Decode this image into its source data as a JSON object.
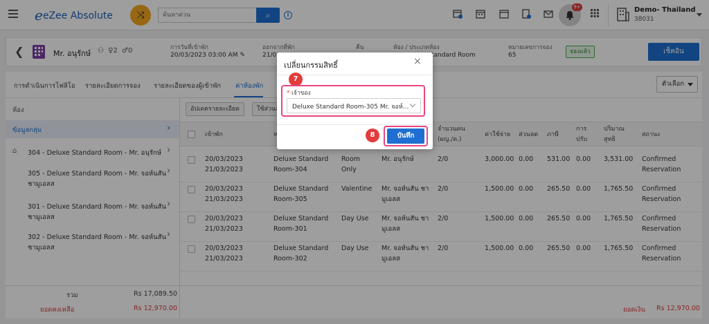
{
  "app": {
    "logo_text": "eZee Absolute",
    "search_placeholder": "ค้นหาด่วน",
    "notification_count": "9+",
    "property_name": "Demo- Thailand",
    "property_id": "38031"
  },
  "reservation": {
    "guest_name": "Mr. อนุรักษ์",
    "adults": "2",
    "children": "0",
    "arrival_label": "การวันที่เข้าพัก",
    "arrival_value": "20/03/2023 03:00 AM",
    "departure_label": "ออกจากที่พัก",
    "departure_value": "21/0",
    "nights_label": "คืน",
    "room_label": "ห้อง / ประเภทห้อง",
    "room_value": "tandard Room",
    "resno_label": "หมายเลขการจอง",
    "resno_value": "65",
    "status_badge": "จองแล้ว",
    "checkin_button": "เช็คอิน"
  },
  "tabs": [
    {
      "label": "การดำเนินการโฟลิโอ"
    },
    {
      "label": "รายละเอียดการจอง"
    },
    {
      "label": "รายละเอียดของผู้เข้าพัก"
    },
    {
      "label": "ค่าห้องพัก"
    }
  ],
  "options_button": "ตัวเลือก",
  "left": {
    "title": "ห้อง",
    "group": "ข้อมูลกลุ่ม",
    "rooms": [
      {
        "line1": "304 - Deluxe Standard Room - Mr. อนุรักษ์",
        "line2": ""
      },
      {
        "line1": "305 - Deluxe Standard Room - Mr. จอห์นสัน",
        "line2": "ชามูเอลส"
      },
      {
        "line1": "301 - Deluxe Standard Room - Mr. จอห์นสัน",
        "line2": "ชามูเอลส"
      },
      {
        "line1": "302 - Deluxe Standard Room - Mr. จอห์นสัน",
        "line2": "ชามูเอลส"
      }
    ],
    "total_label": "รวม",
    "total_value": "Rs 17,089.50",
    "balance_label": "ยอดคงเหลือ",
    "balance_value": "Rs 12,970.00"
  },
  "main": {
    "update_button": "อัปเดตรายละเอียด",
    "discount_button": "ใช้ส่วนล",
    "headers": {
      "checkin": "เข้าพัก",
      "room": "ห",
      "guests": "จำนวนคน",
      "guests2": "(ผญ./ด.)",
      "rate": "ค่าใช้จ่าย",
      "discount": "ส่วนลด",
      "tax": "ภาษี",
      "adjust": "การ",
      "adjust2": "ปรับ",
      "net": "ปริมาณ",
      "net2": "สุทธิ",
      "status": "สถานะ"
    },
    "rows": [
      {
        "d1": "20/03/2023",
        "d2": "21/03/2023",
        "r1": "Deluxe Standard",
        "r2": "Room-304",
        "p1": "Room",
        "p2": "Only",
        "g1": "Mr. อนุรักษ์",
        "g2": "",
        "pax": "2/0",
        "rate": "3,000.00",
        "disc": "0.00",
        "tax": "531.00",
        "adj": "0.00",
        "net": "3,531.00",
        "s1": "Confirmed",
        "s2": "Reservation"
      },
      {
        "d1": "20/03/2023",
        "d2": "21/03/2023",
        "r1": "Deluxe Standard",
        "r2": "Room-305",
        "p1": "Valentine",
        "p2": "",
        "g1": "Mr. จอห์นสัน ชา",
        "g2": "มูเอลส",
        "pax": "2/0",
        "rate": "1,500.00",
        "disc": "0.00",
        "tax": "265.50",
        "adj": "0.00",
        "net": "1,765.50",
        "s1": "Confirmed",
        "s2": "Reservation"
      },
      {
        "d1": "20/03/2023",
        "d2": "21/03/2023",
        "r1": "Deluxe Standard",
        "r2": "Room-301",
        "p1": "Day Use",
        "p2": "",
        "g1": "Mr. จอห์นสัน ชา",
        "g2": "มูเอลส",
        "pax": "2/0",
        "rate": "1,500.00",
        "disc": "0.00",
        "tax": "265.50",
        "adj": "0.00",
        "net": "1,765.50",
        "s1": "Confirmed",
        "s2": "Reservation"
      },
      {
        "d1": "20/03/2023",
        "d2": "21/03/2023",
        "r1": "Deluxe Standard",
        "r2": "Room-302",
        "p1": "Day Use",
        "p2": "",
        "g1": "Mr. จอห์นสัน ชา",
        "g2": "มูเอลส",
        "pax": "2/0",
        "rate": "1,500.00",
        "disc": "0.00",
        "tax": "265.50",
        "adj": "0.00",
        "net": "1,765.50",
        "s1": "Confirmed",
        "s2": "Reservation"
      }
    ],
    "footer_label": "ยอดเงิน",
    "footer_value": "Rs 12,970.00"
  },
  "modal": {
    "title": "เปลี่ยนกรรมสิทธิ์",
    "field_label": "เจ้าของ",
    "field_required": "*",
    "select_value": "Deluxe Standard Room-305 Mr. จอห์...",
    "save_button": "บันทึก",
    "step7": "7",
    "step8": "8"
  },
  "colors": {
    "primary": "#1e6fd1",
    "highlight": "#e8457f",
    "step_badge": "#e23c3c",
    "balance": "#e03a3a",
    "status_green": "#4caf50"
  }
}
